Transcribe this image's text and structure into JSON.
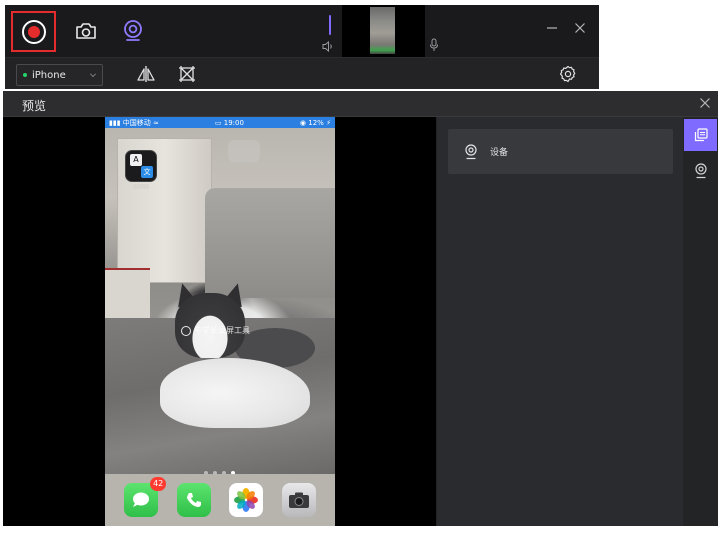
{
  "toolbar": {
    "device": {
      "selected": "iPhone"
    }
  },
  "preview": {
    "title": "预览",
    "statusbar": {
      "carrier": "中国移动",
      "time": "19:00",
      "battery": "12%"
    },
    "watermark": "牛学长录屏工具",
    "messages_badge": "42",
    "page_dots_count": 4,
    "page_dots_active_index": 3
  },
  "side_panel": {
    "device_item_label": "设备"
  },
  "colors": {
    "record_red": "#e52c2c",
    "accent_purple": "#7f6bff",
    "statusbar_blue": "#2a7fe0",
    "status_green": "#27d06a"
  },
  "icons": {
    "record": "record-icon",
    "screenshot": "camera-icon",
    "webcam": "webcam-icon",
    "speaker": "speaker-icon",
    "microphone": "microphone-icon",
    "mirror": "flip-horizontal-icon",
    "crop": "crop-icon",
    "settings": "gear-icon",
    "minimize": "minimize-icon",
    "close": "close-icon"
  }
}
